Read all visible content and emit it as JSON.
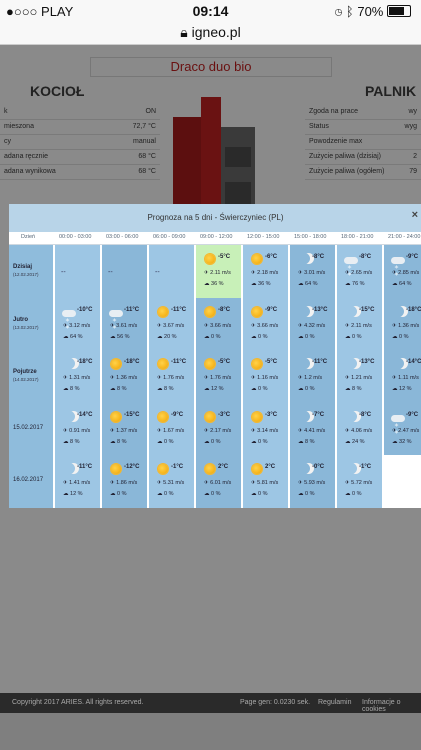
{
  "status_bar": {
    "carrier": "●○○○ PLAY",
    "time": "09:14",
    "battery": "70%"
  },
  "url": "igneo.pl",
  "background": {
    "title": "Draco duo bio",
    "left_heading": "KOCIOŁ",
    "right_heading": "PALNIK",
    "left_rows": [
      [
        "k",
        "ON"
      ],
      [
        "mieszona",
        "72,7 °C"
      ],
      [
        "cy",
        "manual"
      ],
      [
        "adana ręcznie",
        "68 °C"
      ],
      [
        "adana wynikowa",
        "68 °C"
      ]
    ],
    "right_rows": [
      [
        "Zgoda na prace",
        "wy"
      ],
      [
        "Status",
        "wyg"
      ],
      [
        "Powodzenie max",
        ""
      ],
      [
        "Zużycie paliwa (dzisiaj)",
        "2"
      ],
      [
        "Zużycie paliwa (ogółem)",
        "79"
      ]
    ],
    "footer_left": "Copyright 2017 ARIES. All rights reserved.",
    "footer_time": "Page gen: 0.0230 sek.",
    "footer_links": [
      "Regulamin",
      "Informacje o cookies"
    ]
  },
  "modal": {
    "title": "Prognoza na 5 dni - Świerczyniec (PL)",
    "close": "×",
    "columns": [
      "Dzień",
      "00:00 - 03:00",
      "03:00 - 06:00",
      "06:00 - 09:00",
      "09:00 - 12:00",
      "12:00 - 15:00",
      "15:00 - 18:00",
      "18:00 - 21:00",
      "21:00 - 24:00"
    ],
    "days": [
      {
        "name": "Dzisiaj",
        "date": "(12.02.2017)",
        "cells": [
          {
            "empty": "--"
          },
          {
            "empty": "--"
          },
          {
            "empty": "--"
          },
          {
            "icon": "sun",
            "temp": "-5°C",
            "wind": "2.11 m/s",
            "precip": "36 %",
            "now": true
          },
          {
            "icon": "sun",
            "temp": "-6°C",
            "wind": "2.18 m/s",
            "precip": "36 %"
          },
          {
            "icon": "moon",
            "temp": "-8°C",
            "wind": "3.01 m/s",
            "precip": "64 %"
          },
          {
            "icon": "snow",
            "temp": "-8°C",
            "wind": "2.65 m/s",
            "precip": "76 %"
          },
          {
            "icon": "snow",
            "temp": "-9°C",
            "wind": "2.85 m/s",
            "precip": "64 %"
          }
        ]
      },
      {
        "name": "Jutro",
        "date": "(13.02.2017)",
        "cells": [
          {
            "icon": "snow",
            "temp": "-10°C",
            "wind": "3.12 m/s",
            "precip": "64 %"
          },
          {
            "icon": "snow",
            "temp": "-11°C",
            "wind": "3.61 m/s",
            "precip": "56 %"
          },
          {
            "icon": "sun",
            "temp": "-11°C",
            "wind": "3.67 m/s",
            "precip": "20 %"
          },
          {
            "icon": "sun",
            "temp": "-8°C",
            "wind": "3.66 m/s",
            "precip": "0 %"
          },
          {
            "icon": "sun",
            "temp": "-9°C",
            "wind": "3.66 m/s",
            "precip": "0 %"
          },
          {
            "icon": "moon",
            "temp": "-13°C",
            "wind": "4.32 m/s",
            "precip": "0 %"
          },
          {
            "icon": "moon",
            "temp": "-15°C",
            "wind": "2.11 m/s",
            "precip": "0 %"
          },
          {
            "icon": "moon",
            "temp": "-18°C",
            "wind": "1.36 m/s",
            "precip": "0 %"
          }
        ]
      },
      {
        "name": "Pojutrze",
        "date": "(14.02.2017)",
        "cells": [
          {
            "icon": "moon",
            "temp": "-18°C",
            "wind": "1.31 m/s",
            "precip": "8 %"
          },
          {
            "icon": "sun",
            "temp": "-18°C",
            "wind": "1.36 m/s",
            "precip": "8 %"
          },
          {
            "icon": "sun",
            "temp": "-11°C",
            "wind": "1.76 m/s",
            "precip": "8 %"
          },
          {
            "icon": "sun",
            "temp": "-5°C",
            "wind": "1.76 m/s",
            "precip": "12 %"
          },
          {
            "icon": "sun",
            "temp": "-5°C",
            "wind": "1.16 m/s",
            "precip": "0 %"
          },
          {
            "icon": "moon",
            "temp": "-11°C",
            "wind": "1.2 m/s",
            "precip": "0 %"
          },
          {
            "icon": "moon",
            "temp": "-13°C",
            "wind": "1.21 m/s",
            "precip": "8 %"
          },
          {
            "icon": "moon",
            "temp": "-14°C",
            "wind": "1.11 m/s",
            "precip": "12 %"
          }
        ]
      },
      {
        "name": "15.02.2017",
        "date": "",
        "cells": [
          {
            "icon": "moon",
            "temp": "-14°C",
            "wind": "0.91 m/s",
            "precip": "8 %"
          },
          {
            "icon": "sun",
            "temp": "-15°C",
            "wind": "1.37 m/s",
            "precip": "8 %"
          },
          {
            "icon": "sun",
            "temp": "-9°C",
            "wind": "1.67 m/s",
            "precip": "0 %"
          },
          {
            "icon": "sun",
            "temp": "-3°C",
            "wind": "2.17 m/s",
            "precip": "0 %"
          },
          {
            "icon": "sun",
            "temp": "-3°C",
            "wind": "3.14 m/s",
            "precip": "0 %"
          },
          {
            "icon": "moon",
            "temp": "-7°C",
            "wind": "4.41 m/s",
            "precip": "8 %"
          },
          {
            "icon": "moon",
            "temp": "-8°C",
            "wind": "4.06 m/s",
            "precip": "24 %"
          },
          {
            "icon": "snow",
            "temp": "-9°C",
            "wind": "2.47 m/s",
            "precip": "32 %"
          }
        ]
      },
      {
        "name": "16.02.2017",
        "date": "",
        "cells": [
          {
            "icon": "moon",
            "temp": "-11°C",
            "wind": "1.41 m/s",
            "precip": "12 %"
          },
          {
            "icon": "sun",
            "temp": "-12°C",
            "wind": "1.86 m/s",
            "precip": "0 %"
          },
          {
            "icon": "sun",
            "temp": "-1°C",
            "wind": "5.31 m/s",
            "precip": "0 %"
          },
          {
            "icon": "sun",
            "temp": "2°C",
            "wind": "6.01 m/s",
            "precip": "0 %"
          },
          {
            "icon": "sun",
            "temp": "2°C",
            "wind": "5.81 m/s",
            "precip": "0 %"
          },
          {
            "icon": "moon",
            "temp": "-0°C",
            "wind": "5.93 m/s",
            "precip": "0 %"
          },
          {
            "icon": "moon",
            "temp": "-1°C",
            "wind": "5.72 m/s",
            "precip": "0 %"
          },
          {
            "blank": true
          }
        ]
      }
    ]
  }
}
